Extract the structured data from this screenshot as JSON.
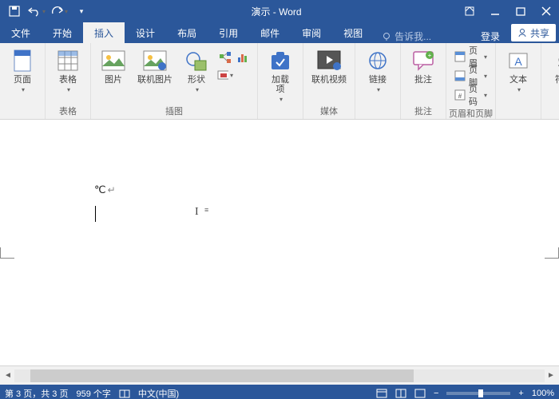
{
  "titlebar": {
    "title": "演示 - Word"
  },
  "qat": {
    "save": "保存",
    "undo": "撤销",
    "redo": "恢复"
  },
  "tabs": {
    "file": "文件",
    "home": "开始",
    "insert": "插入",
    "design": "设计",
    "layout": "布局",
    "references": "引用",
    "mailings": "邮件",
    "review": "审阅",
    "view": "视图"
  },
  "tellme": "告诉我...",
  "signin": "登录",
  "share": "共享",
  "ribbon": {
    "pages": {
      "label": "",
      "page": "页面"
    },
    "tables": {
      "label": "表格",
      "table": "表格"
    },
    "illustrations": {
      "label": "插图",
      "picture": "图片",
      "online_picture": "联机图片",
      "shapes": "形状"
    },
    "addins": {
      "label": "",
      "addin": "加载\n项",
      "store": "应用商店"
    },
    "media": {
      "label": "媒体",
      "video": "联机视频"
    },
    "links": {
      "label": "",
      "link": "链接"
    },
    "comments": {
      "label": "批注",
      "comment": "批注"
    },
    "headerfooter": {
      "label": "页眉和页脚",
      "header": "页眉",
      "footer": "页脚",
      "pagenum": "页码"
    },
    "text": {
      "label": "",
      "textbox": "文本"
    },
    "symbols": {
      "label": "",
      "symbol": "符号"
    }
  },
  "document": {
    "text": "℃",
    "cursor_char": "I",
    "cursor_marks": "≡"
  },
  "status": {
    "page": "第 3 页，共 3 页",
    "words": "959 个字",
    "spellcheck_icon": "book",
    "lang": "中文(中国)",
    "zoom": "100%",
    "zoom_out": "−",
    "zoom_in": "+"
  }
}
